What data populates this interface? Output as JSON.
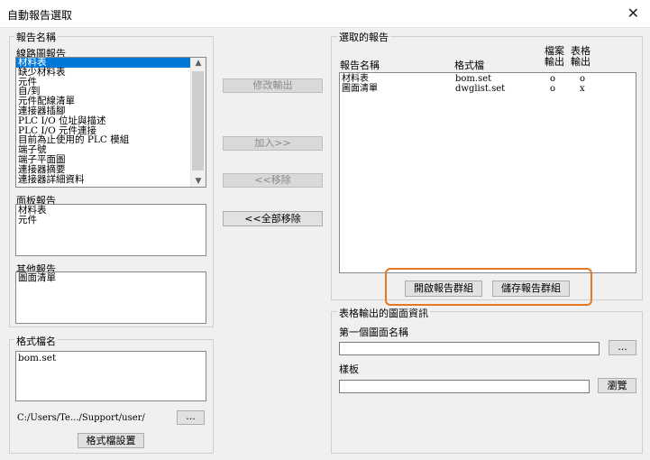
{
  "window": {
    "title": "自動報告選取",
    "close_symbol": "✕"
  },
  "left": {
    "report_names_group": "報告名稱",
    "wiring_reports_label": "線路圖報告",
    "wiring_reports": [
      "材料表",
      "缺少材料表",
      "元件",
      "自/到",
      "元件配線清單",
      "連接器插腳",
      "PLC I/O 位址與描述",
      "PLC I/O 元件連接",
      "目前為止使用的 PLC 模組",
      "端子號",
      "端子平面圖",
      "連接器摘要",
      "連接器詳細資料"
    ],
    "panel_reports_label": "面板報告",
    "panel_reports": [
      "材料表",
      "元件"
    ],
    "other_reports_label": "其他報告",
    "other_reports": [
      "圖面清單"
    ],
    "format_group": "格式檔名",
    "format_files": [
      "bom.set"
    ],
    "format_path": "C:/Users/Te.../Support/user/",
    "browse_dots": "...",
    "format_setup_button": "格式檔設置"
  },
  "middle": {
    "modify_output": "修改輸出",
    "add": "加入>>",
    "remove": "<<移除",
    "remove_all": "<<全部移除"
  },
  "right": {
    "selected_group": "選取的報告",
    "col_name": "報告名稱",
    "col_format": "格式檔",
    "col_file_out": "檔案\n輸出",
    "col_table_out": "表格\n輸出",
    "rows": [
      {
        "name": "材料表",
        "format": "bom.set",
        "file": "o",
        "table": "o"
      },
      {
        "name": "圖面清單",
        "format": "dwglist.set",
        "file": "o",
        "table": "x"
      }
    ],
    "open_group_button": "開啟報告群組",
    "save_group_button": "儲存報告群組",
    "table_output_group": "表格輸出的圖面資訊",
    "first_drawing_label": "第一個圖面名稱",
    "first_drawing_value": "",
    "template_label": "樣板",
    "template_value": "",
    "browse_dots": "...",
    "browse_button": "瀏覽"
  },
  "colors": {
    "highlight": "#e87722",
    "selection": "#0078d7"
  }
}
